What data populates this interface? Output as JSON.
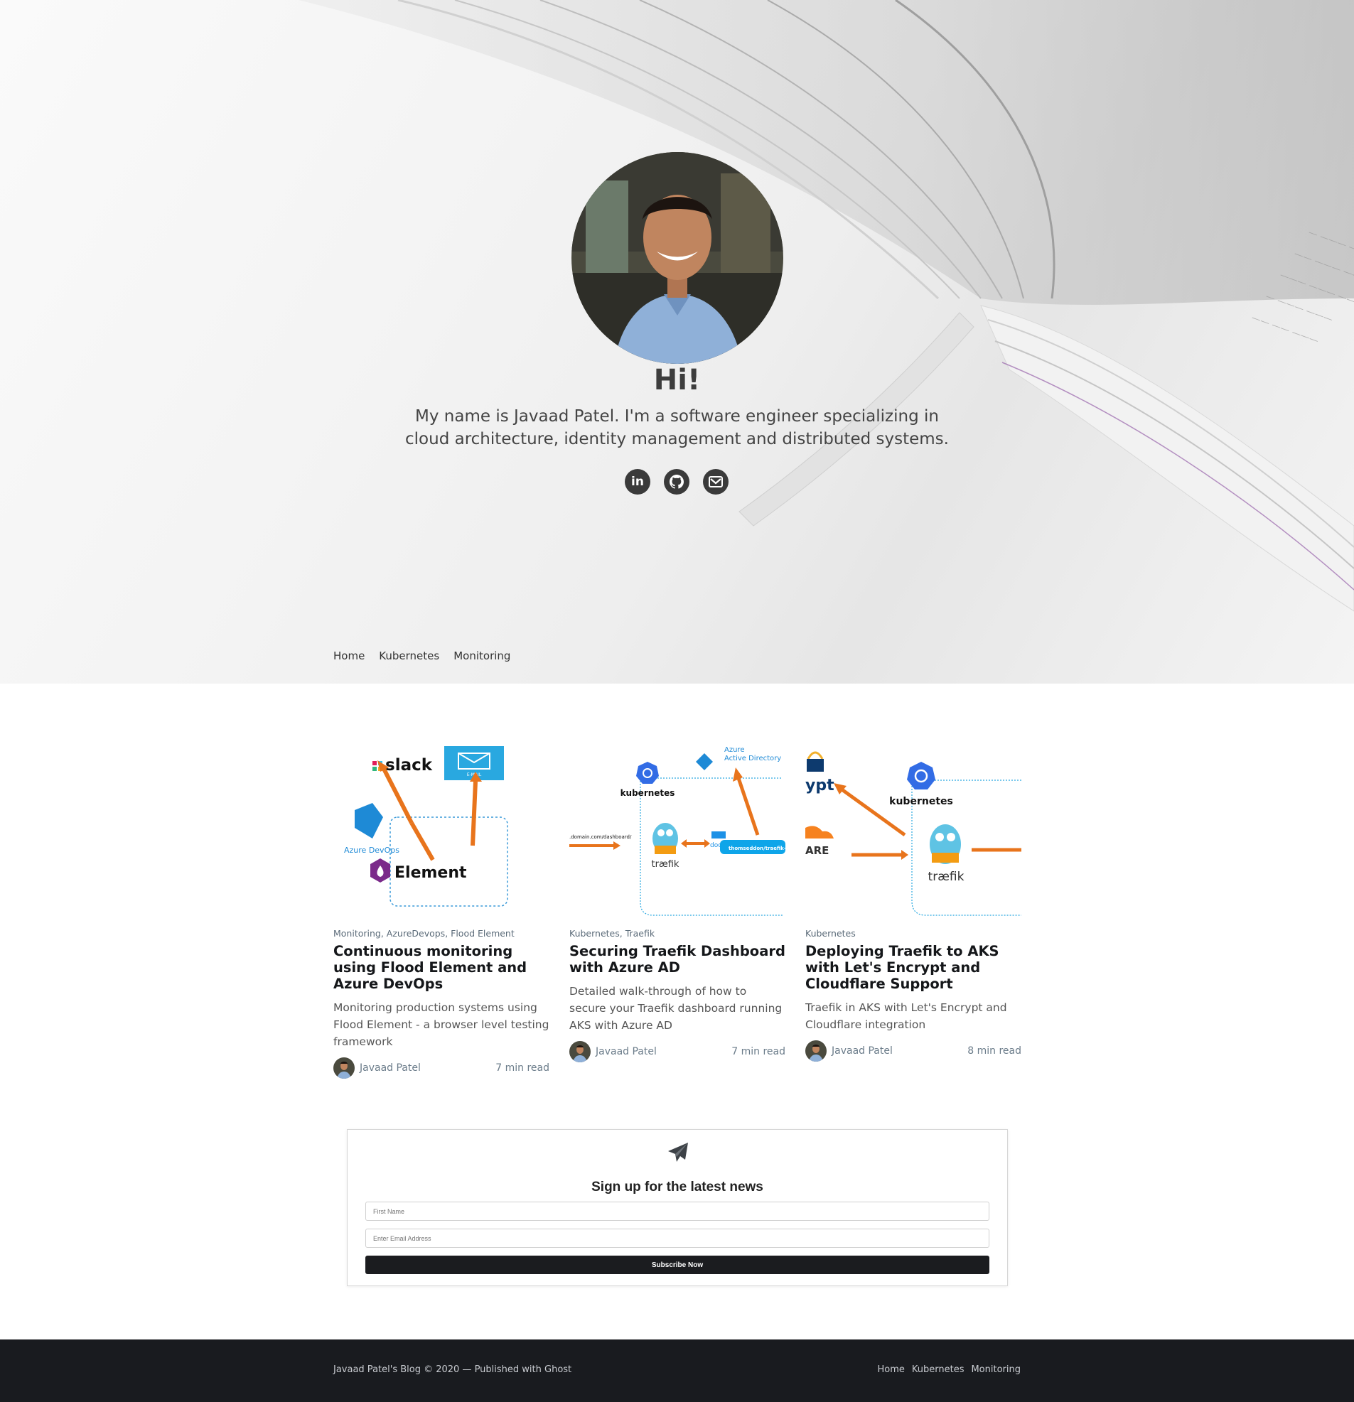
{
  "hero": {
    "title": "Hi!",
    "description": "My name is Javaad Patel. I'm a software engineer specializing in cloud architecture, identity management and distributed systems.",
    "social": [
      {
        "icon": "linkedin-icon",
        "label": "in"
      },
      {
        "icon": "github-icon"
      },
      {
        "icon": "email-icon"
      }
    ]
  },
  "nav": {
    "items": [
      "Home",
      "Kubernetes",
      "Monitoring"
    ]
  },
  "posts": [
    {
      "tags": "Monitoring, AzureDevops, Flood Element",
      "title": "Continuous monitoring using Flood Element and Azure DevOps",
      "excerpt": "Monitoring production systems using Flood Element - a browser level testing framework",
      "author": "Javaad Patel",
      "read_time": "7 min read",
      "image_text": {
        "slack": "slack",
        "email": "E-MAIL",
        "azure": "Azure DevOps",
        "element": "Element"
      }
    },
    {
      "tags": "Kubernetes, Traefik",
      "title": "Securing Traefik Dashboard with Azure AD",
      "excerpt": "Detailed walk-through of how to secure your Traefik dashboard running AKS with Azure AD",
      "author": "Javaad Patel",
      "read_time": "7 min read",
      "image_text": {
        "aad1": "Azure",
        "aad2": "Active Directory",
        "k8s": "kubernetes",
        "url": ".domain.com/dashboard/",
        "traefik": "træfik",
        "docker": "dock",
        "image": "thomseddon/traefik-fo"
      }
    },
    {
      "tags": "Kubernetes",
      "title": "Deploying Traefik to AKS with Let's Encrypt and Cloudflare Support",
      "excerpt": "Traefik in AKS with Let's Encrypt and Cloudflare integration",
      "author": "Javaad Patel",
      "read_time": "8 min read",
      "image_text": {
        "ypt": "ypt",
        "are": "ARE",
        "k8s": "kubernetes",
        "traefik": "træfik"
      }
    }
  ],
  "subscribe": {
    "title": "Sign up for the latest news",
    "first_name_placeholder": "First Name",
    "email_placeholder": "Enter Email Address",
    "button": "Subscribe Now"
  },
  "footer": {
    "copyright": "Javaad Patel's Blog © 2020 — Published with Ghost",
    "nav": [
      "Home",
      "Kubernetes",
      "Monitoring"
    ]
  },
  "colors": {
    "footer_bg": "#191b1f",
    "button_bg": "#1b1c1f",
    "arrow_orange": "#e8741c",
    "azure_blue": "#1e8ad6",
    "k8s_blue": "#326ce5"
  }
}
